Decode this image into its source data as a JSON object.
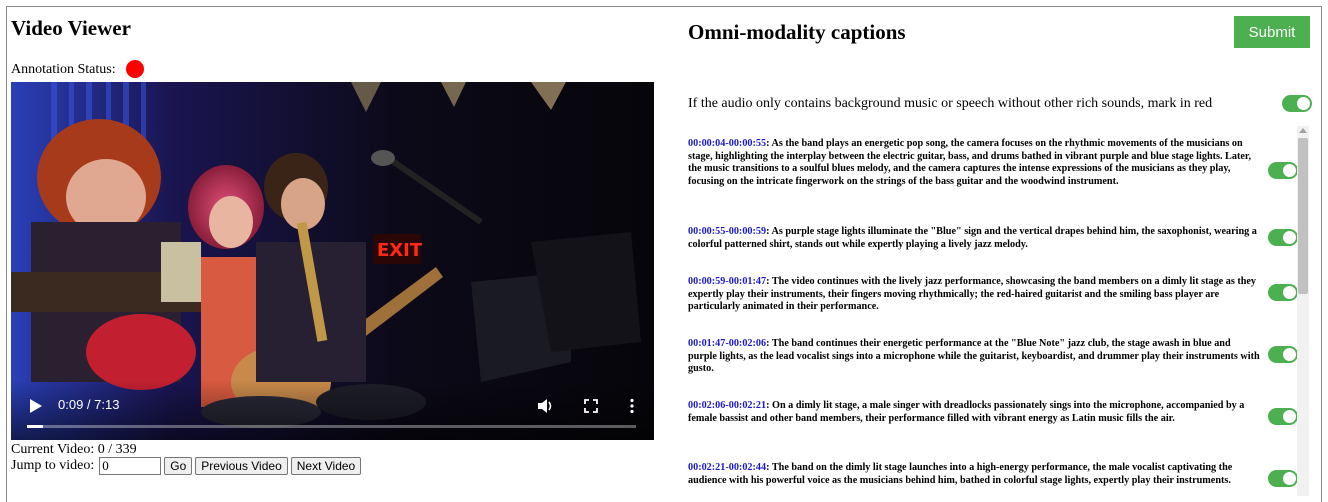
{
  "viewer": {
    "title": "Video Viewer",
    "annotation_status_label": "Annotation Status:",
    "annotation_status_color": "#ff0000",
    "time_display": "0:09 / 7:13",
    "progress_fraction": 0.027,
    "current_video_text": "Current Video: 0 / 339",
    "jump_label": "Jump to video:",
    "jump_value": "0",
    "go_label": "Go",
    "prev_label": "Previous Video",
    "next_label": "Next Video",
    "icons": [
      "play-icon",
      "volume-icon",
      "fullscreen-icon",
      "more-options-icon"
    ],
    "scene_text": "EXIT"
  },
  "captions_panel": {
    "title": "Omni-modality captions",
    "submit_label": "Submit",
    "submit_color": "#4caf50",
    "instruction": "If the audio only contains background music or speech without other rich sounds, mark in red",
    "instruction_toggle_on": true,
    "toggle_color": "#4caf50",
    "timestamp_color": "#1a1acc",
    "captions": [
      {
        "ts": "00:00:04-00:00:55",
        "text": "As the band plays an energetic pop song, the camera focuses on the rhythmic movements of the musicians on stage, highlighting the interplay between the electric guitar, bass, and drums bathed in vibrant purple and blue stage lights. Later, the music transitions to a soulful blues melody, and the camera captures the intense expressions of the musicians as they play, focusing on the intricate fingerwork on the strings of the bass guitar and the woodwind instrument.",
        "on": true
      },
      {
        "ts": "00:00:55-00:00:59",
        "text": "As purple stage lights illuminate the \"Blue\" sign and the vertical drapes behind him, the saxophonist, wearing a colorful patterned shirt, stands out while expertly playing a lively jazz melody.",
        "on": true
      },
      {
        "ts": "00:00:59-00:01:47",
        "text": "The video continues with the lively jazz performance, showcasing the band members on a dimly lit stage as they expertly play their instruments, their fingers moving rhythmically; the red-haired guitarist and the smiling bass player are particularly animated in their performance.",
        "on": true
      },
      {
        "ts": "00:01:47-00:02:06",
        "text": "The band continues their energetic performance at the \"Blue Note\" jazz club, the stage awash in blue and purple lights, as the lead vocalist sings into a microphone while the guitarist, keyboardist, and drummer play their instruments with gusto.",
        "on": true
      },
      {
        "ts": "00:02:06-00:02:21",
        "text": "On a dimly lit stage, a male singer with dreadlocks passionately sings into the microphone, accompanied by a female bassist and other band members, their performance filled with vibrant energy as Latin music fills the air.",
        "on": true
      },
      {
        "ts": "00:02:21-00:02:44",
        "text": "The band on the dimly lit stage launches into a high-energy performance, the male vocalist captivating the audience with his powerful voice as the musicians behind him, bathed in colorful stage lights, expertly play their instruments.",
        "on": true
      }
    ]
  }
}
